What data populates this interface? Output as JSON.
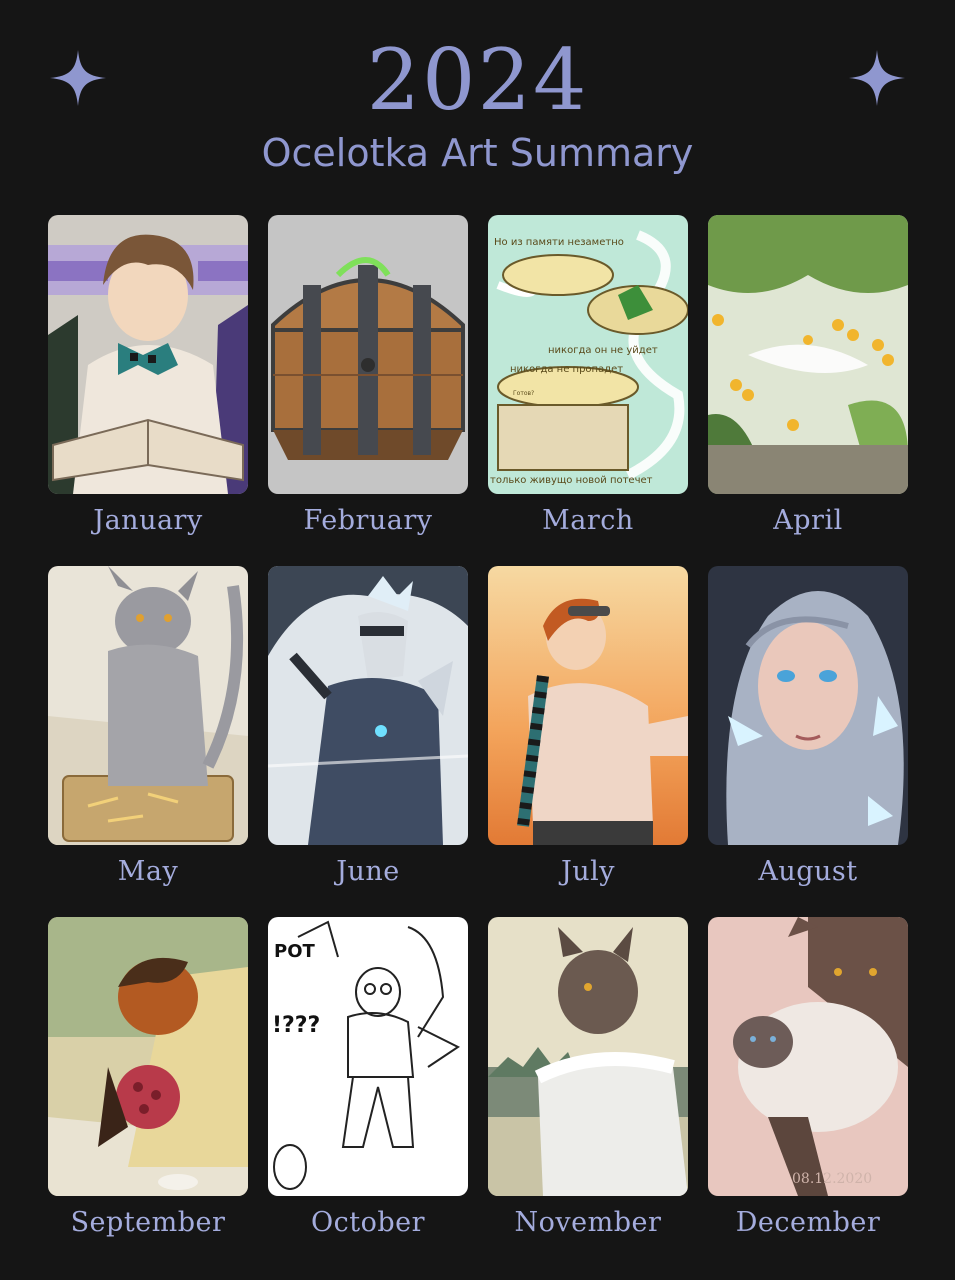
{
  "header": {
    "year": "2024",
    "subtitle": "Ocelotka Art Summary",
    "star_icon": "four-point-sparkle",
    "accent_color": "#8f97cf"
  },
  "months": [
    {
      "label": "January",
      "artwork": "boy reading a book"
    },
    {
      "label": "February",
      "artwork": "wooden treasure chest"
    },
    {
      "label": "March",
      "artwork": "comic page"
    },
    {
      "label": "April",
      "artwork": "fish in pond with coins"
    },
    {
      "label": "May",
      "artwork": "grey cat creature at table"
    },
    {
      "label": "June",
      "artwork": "masked knight in armor"
    },
    {
      "label": "July",
      "artwork": "boy with goggles at sunset"
    },
    {
      "label": "August",
      "artwork": "silver-haired woman"
    },
    {
      "label": "September",
      "artwork": "fox holding berries"
    },
    {
      "label": "October",
      "artwork": "line sketch"
    },
    {
      "label": "November",
      "artwork": "cat in fur coat"
    },
    {
      "label": "December",
      "artwork": "cats embracing"
    }
  ],
  "march_comic_lines": [
    "Но из памяти незаметно",
    "никогда он не уйдет",
    "никогда не пропадет",
    "только живущо новой потечет"
  ],
  "march_speech": "Готов?",
  "october_text": [
    "РОТ",
    "!???"
  ],
  "december_signature": "08.12.2020"
}
